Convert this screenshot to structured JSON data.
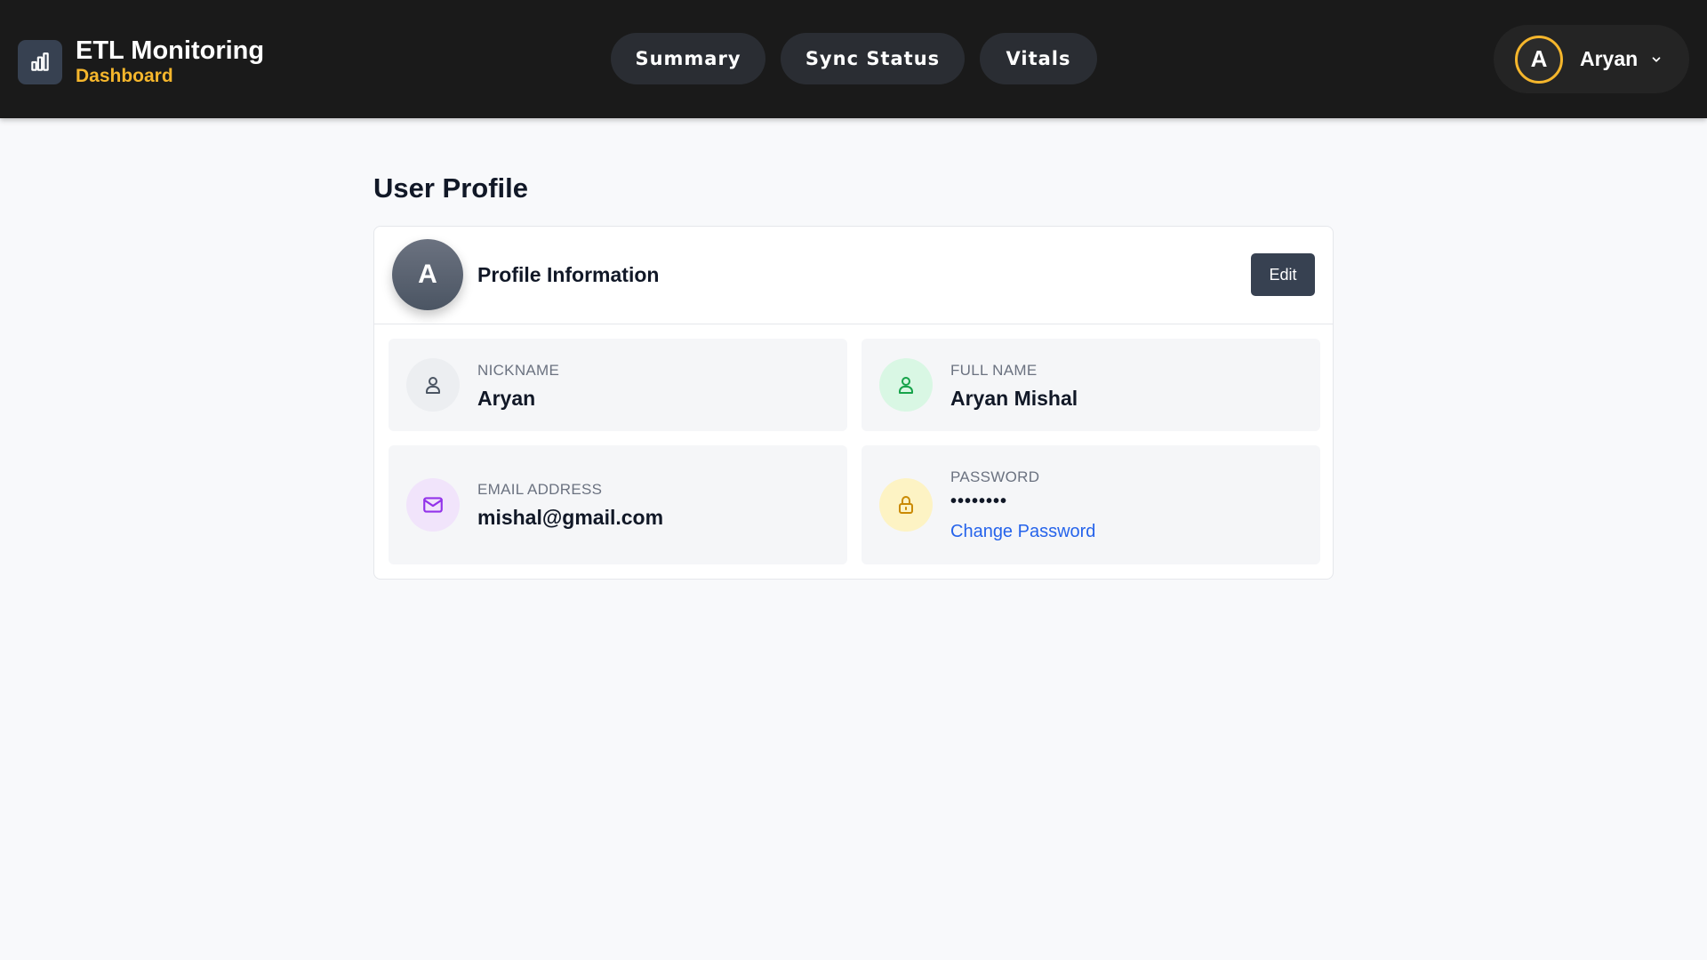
{
  "header": {
    "brand_title": "ETL Monitoring",
    "brand_subtitle": "Dashboard",
    "brand_icon": "bar-chart-icon",
    "nav": [
      {
        "label": "Summary"
      },
      {
        "label": "Sync Status"
      },
      {
        "label": "Vitals"
      }
    ],
    "user": {
      "initial": "A",
      "name": "Aryan",
      "menu_icon": "chevron-down-icon"
    }
  },
  "main": {
    "page_title": "User Profile",
    "card": {
      "avatar_initial": "A",
      "title": "Profile Information",
      "edit_label": "Edit",
      "fields": {
        "nickname": {
          "label": "NICKNAME",
          "value": "Aryan",
          "icon": "user-icon"
        },
        "full_name": {
          "label": "FULL NAME",
          "value": "Aryan Mishal",
          "icon": "user-icon"
        },
        "email": {
          "label": "EMAIL ADDRESS",
          "value": "mishal@gmail.com",
          "icon": "mail-icon"
        },
        "password": {
          "label": "PASSWORD",
          "value": "••••••••",
          "icon": "lock-icon",
          "link": "Change Password"
        }
      }
    }
  },
  "colors": {
    "header_bg": "#1a1a1a",
    "accent": "#f5b62c",
    "link": "#2563eb",
    "button_dark": "#374151",
    "page_bg": "#f8f9fb"
  }
}
